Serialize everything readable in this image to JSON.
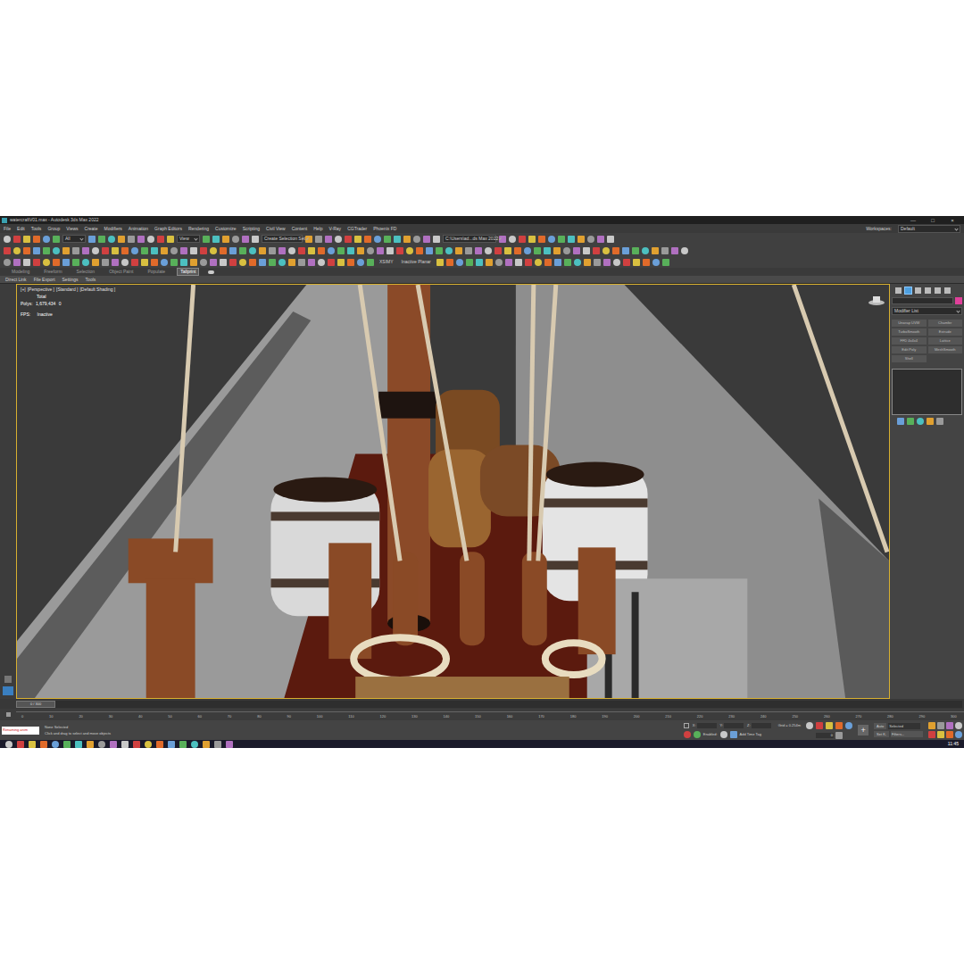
{
  "window": {
    "title": "watercraftV01.max - Autodesk 3ds Max 2022",
    "controls": [
      "—",
      "□",
      "×"
    ]
  },
  "menu": [
    "File",
    "Edit",
    "Tools",
    "Group",
    "Views",
    "Create",
    "Modifiers",
    "Animation",
    "Graph Editors",
    "Rendering",
    "Customize",
    "Scripting",
    "Civil View",
    "Content",
    "Help",
    "V-Ray",
    "CGTrader",
    "Phoenix FD"
  ],
  "workspace": {
    "label": "Workspaces:",
    "value": "Default"
  },
  "toolbar": {
    "selection_filter": "All",
    "ref_coord": "View",
    "selection_set": "Create Selection Set",
    "project_path": "C:\\Users\\ad...ds Max 2022",
    "extras": [
      "XSIMY",
      "Inactive Planar"
    ]
  },
  "ribbon": {
    "tabs": [
      {
        "label": "Modeling",
        "selected": false
      },
      {
        "label": "Freeform",
        "selected": false
      },
      {
        "label": "Selection",
        "selected": false
      },
      {
        "label": "Object Paint",
        "selected": false
      },
      {
        "label": "Populate",
        "selected": false
      },
      {
        "label": "Tallprint",
        "selected": true
      }
    ],
    "panel_items": [
      "Direct Link",
      "File Export",
      "Settings",
      "Tools"
    ]
  },
  "viewport": {
    "labels": [
      "[+]",
      "[Perspective ]",
      "[Standard ]",
      "[Default Shading ]"
    ],
    "stats": {
      "total": "Total",
      "polys_label": "Polys:",
      "polys": "1,679,434",
      "polys_selected": "0",
      "fps_label": "FPS:",
      "fps": "Inactive"
    }
  },
  "command_panel": {
    "tabs": [
      {
        "selected": false
      },
      {
        "selected": true
      },
      {
        "selected": false
      },
      {
        "selected": false
      },
      {
        "selected": false
      },
      {
        "selected": false
      }
    ],
    "dropdown": "Modifier List",
    "buttons": [
      "Unwrap UVW",
      "Chamfer",
      "TurboSmooth",
      "Extrude",
      "FFD 4x4x4",
      "Lattice",
      "Edit Poly",
      "MeshSmooth",
      "Shell"
    ]
  },
  "timeline": {
    "position": "0 / 300",
    "level": 0,
    "ticks": [
      "0",
      "10",
      "20",
      "30",
      "40",
      "50",
      "60",
      "70",
      "80",
      "90",
      "100",
      "110",
      "120",
      "130",
      "140",
      "150",
      "160",
      "170",
      "180",
      "190",
      "200",
      "210",
      "220",
      "230",
      "240",
      "250",
      "260",
      "270",
      "280",
      "290",
      "300"
    ]
  },
  "status": {
    "maxscript": "Renaming anim",
    "selection": "None Selected",
    "prompt": "Click and drag to select and move objects",
    "x": "X:",
    "y": "Y:",
    "z": "Z:",
    "grid": "Grid = 0.254m",
    "enabled": "Enabled:",
    "time_tag": "Add Time Tag",
    "auto": "Auto",
    "selected": "Selected",
    "set_key": "Set K.",
    "filters": "Filters...",
    "frame": "0"
  },
  "taskbar": {
    "clock": "11:45"
  }
}
